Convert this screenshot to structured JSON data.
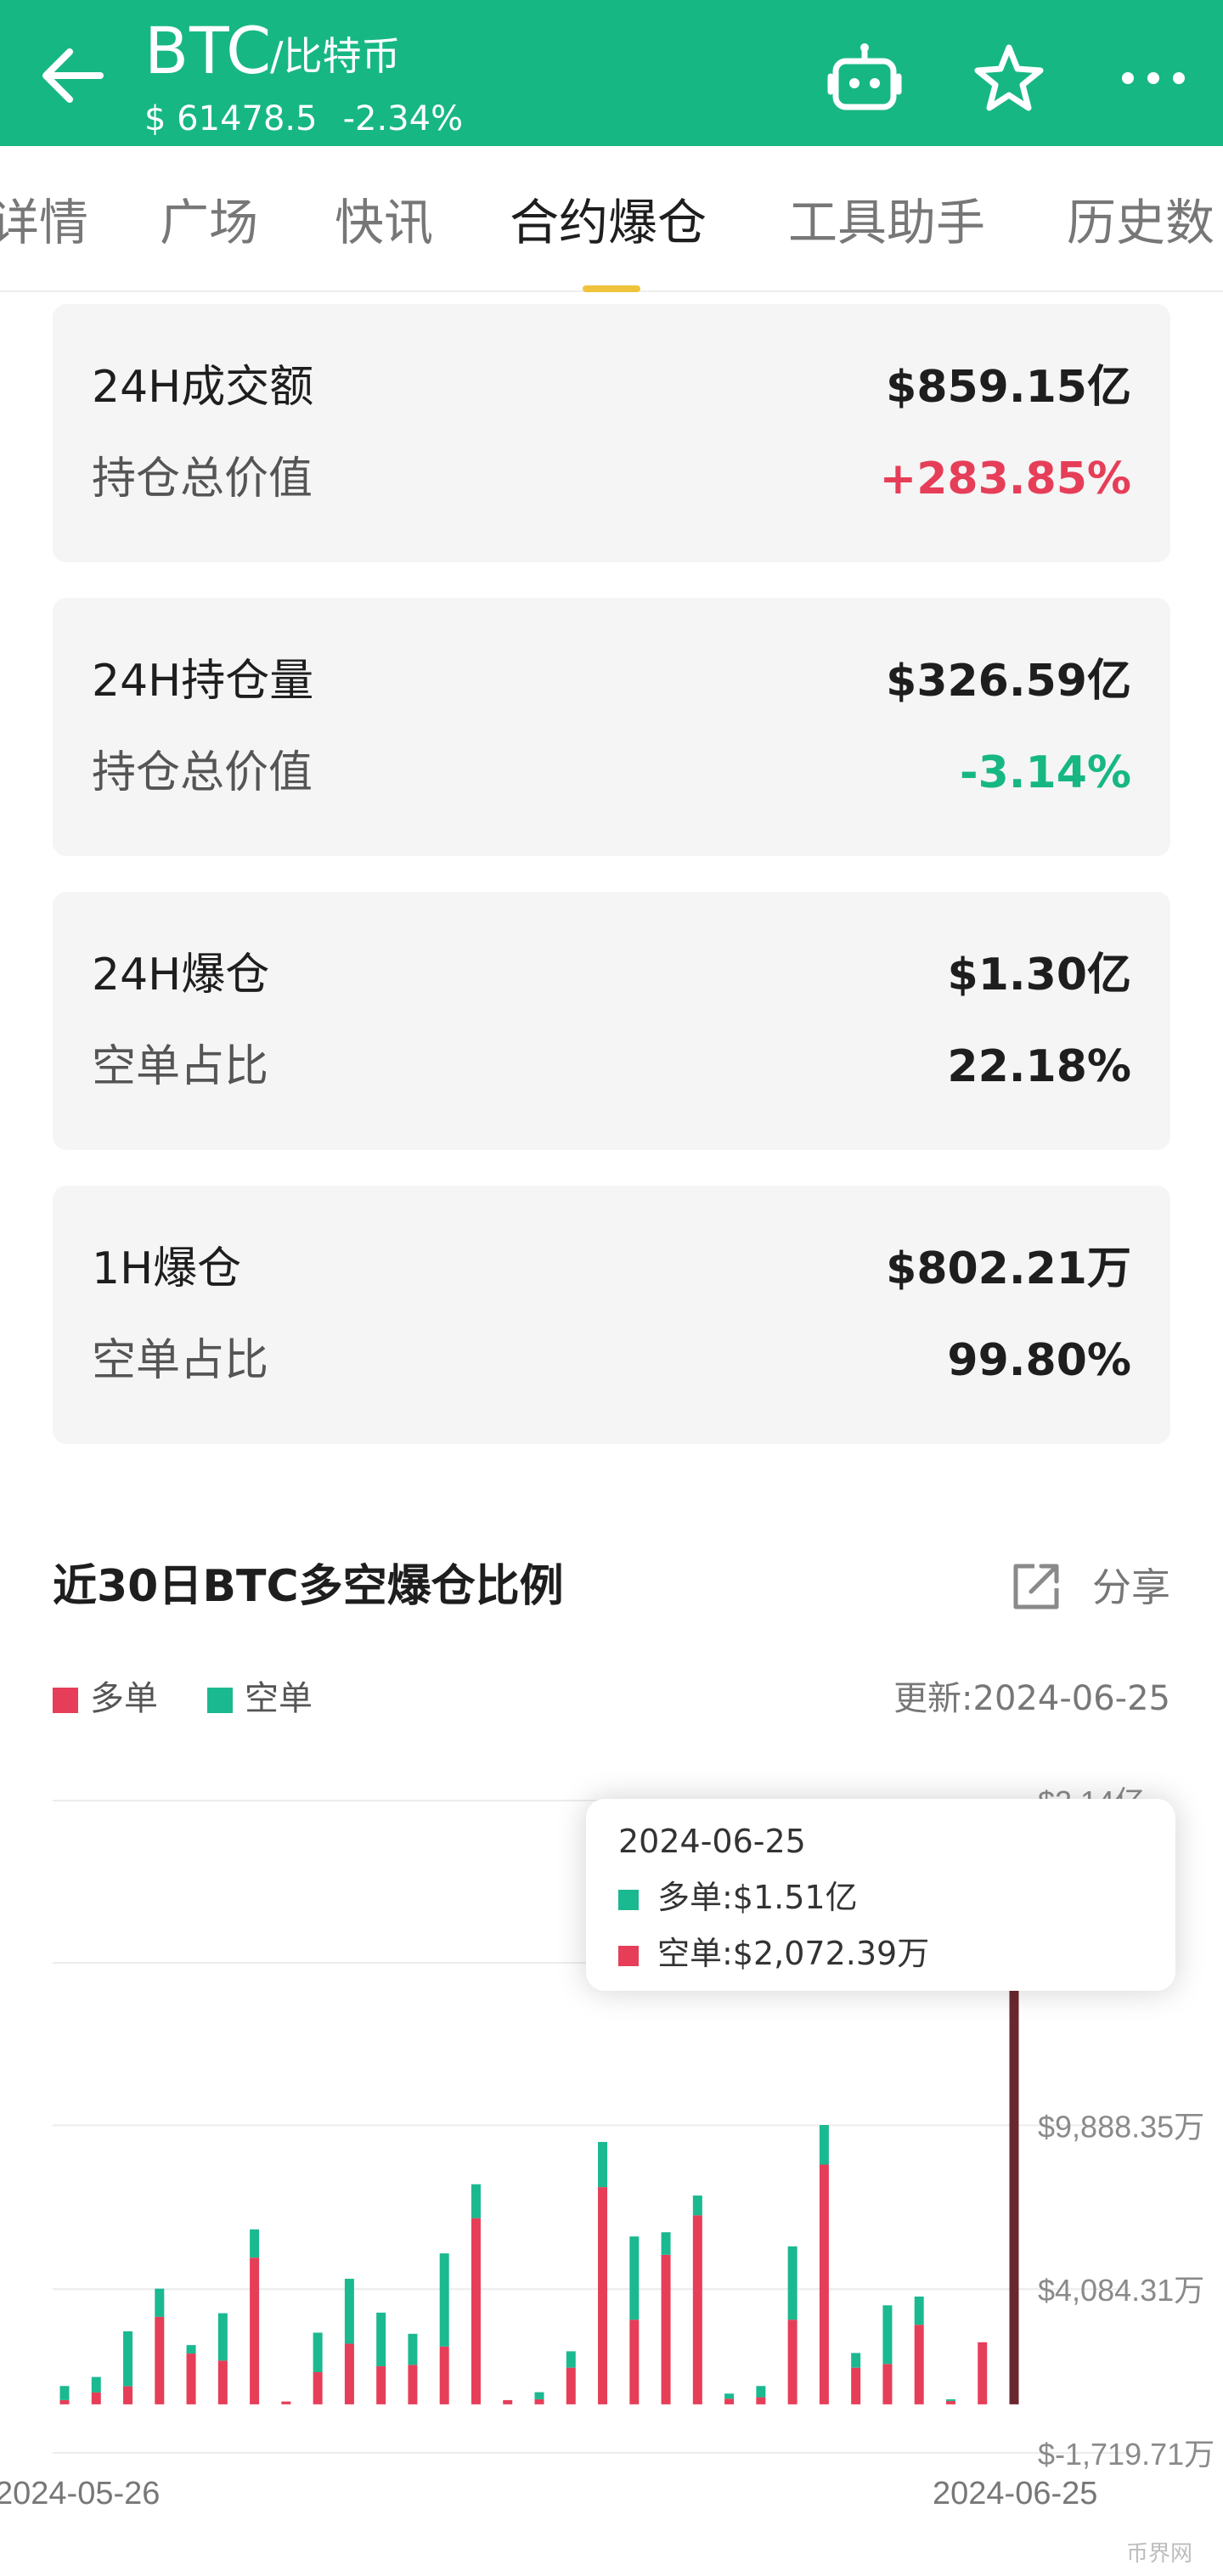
{
  "header": {
    "coin": "BTC",
    "coin_cn": "/比特币",
    "price": "$ 61478.5",
    "change": "-2.34%",
    "icons": [
      "back-arrow-icon",
      "robot-icon",
      "star-icon",
      "more-icon"
    ]
  },
  "tabs": [
    {
      "label": "详情"
    },
    {
      "label": "广场"
    },
    {
      "label": "快讯"
    },
    {
      "label": "合约爆仓"
    },
    {
      "label": "工具助手"
    },
    {
      "label": "历史数"
    }
  ],
  "cards": [
    {
      "label1": "24H成交额",
      "value1": "$859.15亿",
      "label2": "持仓总价值",
      "value2": "+283.85%"
    },
    {
      "label1": "24H持仓量",
      "value1": "$326.59亿",
      "label2": "持仓总价值",
      "value2": "-3.14%"
    },
    {
      "label1": "24H爆仓",
      "value1": "$1.30亿",
      "label2": "空单占比",
      "value2": "22.18%"
    },
    {
      "label1": "1H爆仓",
      "value1": "$802.21万",
      "label2": "空单占比",
      "value2": "99.80%"
    }
  ],
  "colors": {
    "brand": "#17b784",
    "long": "#e63e58",
    "short": "#1bb990",
    "up": "#e63e58",
    "down": "#17b784",
    "highlight": "#6b2730",
    "tab_underline": "#f0c33c"
  },
  "chart_section": {
    "title": "近30日BTC多空爆仓比例",
    "share_label": "分享",
    "legend_long": "多单",
    "legend_short": "空单",
    "updated": "更新:2024-06-25"
  },
  "tooltip": {
    "date": "2024-06-25",
    "row1": "多单:$1.51亿",
    "row2": "空单:$2,072.39万"
  },
  "watermark": "币界网",
  "chart_data": {
    "type": "bar",
    "stacked": true,
    "x_start_label": "2024-05-26",
    "x_end_label": "2024-06-25",
    "y_tick_labels": [
      "$2.14亿",
      "$9,888.35万",
      "$4,084.31万",
      "$-1,719.71万"
    ],
    "y_ticks": [
      21400,
      9888.35,
      4084.31,
      -1719.71
    ],
    "ylim": [
      -1719.71,
      21400
    ],
    "unit": "万",
    "grid": true,
    "series": [
      {
        "name": "多单",
        "values": [
          150,
          420,
          640,
          3100,
          1800,
          1550,
          5200,
          100,
          1140,
          2150,
          1350,
          1400,
          2050,
          6600,
          150,
          180,
          1300,
          7700,
          3000,
          5300,
          6700,
          200,
          250,
          3000,
          8500,
          1300,
          1430,
          2820,
          120,
          2200,
          15100
        ]
      },
      {
        "name": "空单",
        "values": [
          500,
          550,
          1950,
          1000,
          300,
          1680,
          1000,
          0,
          1400,
          2300,
          1900,
          1100,
          3300,
          1200,
          0,
          250,
          580,
          1600,
          2950,
          800,
          700,
          180,
          400,
          2600,
          1400,
          520,
          2080,
          1000,
          60,
          0,
          2072.39
        ]
      }
    ],
    "selected_index": 30
  }
}
